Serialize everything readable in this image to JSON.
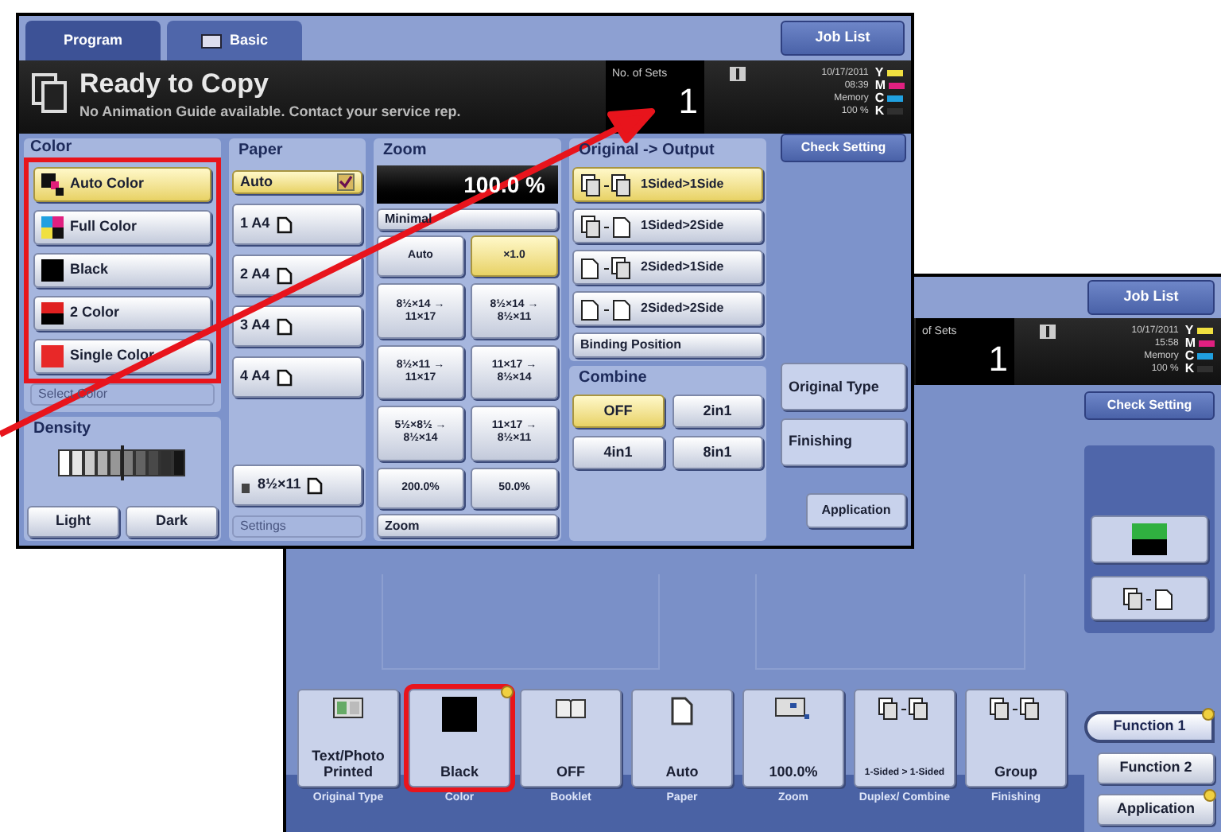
{
  "front_screen": {
    "tabs": [
      {
        "label": "Program",
        "selected": false
      },
      {
        "label": "Basic",
        "selected": true
      }
    ],
    "job_list": "Job List",
    "header": {
      "title": "Ready to Copy",
      "message": "No Animation Guide available. Contact your service rep.",
      "sets_label": "No. of Sets",
      "sets": "1",
      "date": "10/17/2011",
      "time": "08:39",
      "memory_label": "Memory",
      "memory": "100 %",
      "toner": [
        {
          "label": "Y",
          "color": "#f0e040"
        },
        {
          "label": "M",
          "color": "#e02080"
        },
        {
          "label": "C",
          "color": "#20a0e0"
        },
        {
          "label": "K",
          "color": "#303030"
        }
      ]
    },
    "color": {
      "title": "Color",
      "highlighted": true,
      "options": [
        {
          "kind": "auto",
          "label": "Auto Color",
          "selected": true
        },
        {
          "kind": "full",
          "label": "Full Color",
          "selected": false
        },
        {
          "kind": "black",
          "label": "Black",
          "selected": false
        },
        {
          "kind": "two",
          "label": "2 Color",
          "selected": false
        },
        {
          "kind": "single",
          "label": "Single Color",
          "selected": false
        }
      ],
      "select_color": "Select Color"
    },
    "density": {
      "title": "Density",
      "level": 0.5,
      "buttons": [
        "Light",
        "Dark"
      ]
    },
    "paper": {
      "title": "Paper",
      "auto": {
        "label": "Auto",
        "checked": true
      },
      "trays": [
        "1 A4",
        "2 A4",
        "3 A4",
        "4 A4"
      ],
      "bypass": "8½×11",
      "settings": "Settings"
    },
    "zoom": {
      "title": "Zoom",
      "value": "100.0 %",
      "minimal": "Minimal",
      "presets": [
        {
          "label": "Auto",
          "selected": false
        },
        {
          "label": "×1.0",
          "selected": true
        },
        {
          "label": "8½×14 → 11×17",
          "selected": false
        },
        {
          "label": "8½×14 → 8½×11",
          "selected": false
        },
        {
          "label": "8½×11 → 11×17",
          "selected": false
        },
        {
          "label": "11×17 → 8½×14",
          "selected": false
        },
        {
          "label": "5½×8½ → 8½×14",
          "selected": false
        },
        {
          "label": "11×17 → 8½×11",
          "selected": false
        },
        {
          "label": "200.0%",
          "selected": false
        },
        {
          "label": "50.0%",
          "selected": false
        }
      ],
      "footer": "Zoom"
    },
    "duplex": {
      "title": "Original -> Output",
      "options": [
        {
          "kind": "ss",
          "label": "1Sided>1Side",
          "selected": true
        },
        {
          "kind": "sd",
          "label": "1Sided>2Side",
          "selected": false
        },
        {
          "kind": "ds",
          "label": "2Sided>1Side",
          "selected": false
        },
        {
          "kind": "dd",
          "label": "2Sided>2Side",
          "selected": false
        }
      ],
      "binding": "Binding Position"
    },
    "combine": {
      "title": "Combine",
      "options": [
        {
          "label": "OFF",
          "selected": true
        },
        {
          "label": "2in1",
          "selected": false
        },
        {
          "label": "4in1",
          "selected": false
        },
        {
          "label": "8in1",
          "selected": false
        }
      ]
    },
    "side_buttons": {
      "check_setting": "Check Setting",
      "original_type": "Original Type",
      "finishing": "Finishing",
      "application": "Application"
    }
  },
  "back_screen": {
    "job_list": "Job List",
    "sets_label": "of Sets",
    "sets": "1",
    "date": "10/17/2011",
    "time": "15:58",
    "memory_label": "Memory",
    "memory": "100 %",
    "toner": [
      {
        "label": "Y",
        "color": "#f0e040"
      },
      {
        "label": "M",
        "color": "#e02080"
      },
      {
        "label": "C",
        "color": "#20a0e0"
      },
      {
        "label": "K",
        "color": "#303030"
      }
    ],
    "check_setting": "Check Setting",
    "settings": [
      {
        "kind": "original",
        "value": "Text/Photo Printed",
        "label": "Original Type",
        "highlighted": false,
        "badge": false
      },
      {
        "kind": "color",
        "value": "Black",
        "label": "Color",
        "highlighted": true,
        "badge": true
      },
      {
        "kind": "booklet",
        "value": "OFF",
        "label": "Booklet",
        "highlighted": false,
        "badge": false
      },
      {
        "kind": "paper",
        "value": "Auto",
        "label": "Paper",
        "highlighted": false,
        "badge": false
      },
      {
        "kind": "zoom",
        "value": "100.0%",
        "label": "Zoom",
        "highlighted": false,
        "badge": false
      },
      {
        "kind": "duplex",
        "value": "1-Sided > 1-Sided",
        "label": "Duplex/ Combine",
        "highlighted": false,
        "badge": false
      },
      {
        "kind": "finishing",
        "value": "Group",
        "label": "Finishing",
        "highlighted": false,
        "badge": false
      }
    ],
    "functions": [
      {
        "label": "Function 1",
        "selected": true,
        "badge": true
      },
      {
        "label": "Function 2",
        "selected": false,
        "badge": false
      },
      {
        "label": "Application",
        "selected": false,
        "badge": true
      }
    ]
  }
}
